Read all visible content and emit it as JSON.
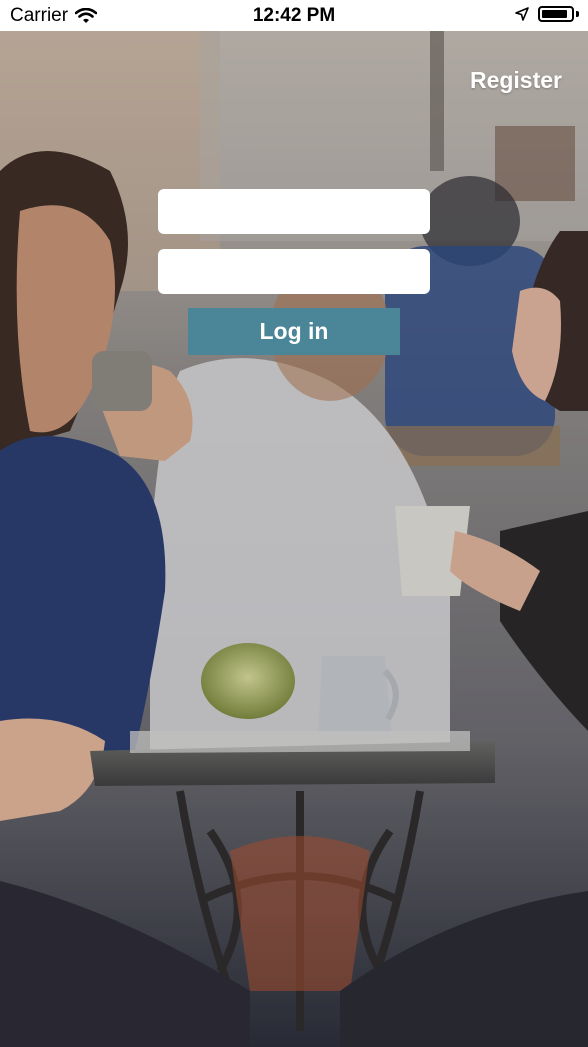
{
  "status_bar": {
    "carrier": "Carrier",
    "time": "12:42 PM",
    "battery_level": 0.9
  },
  "icons": {
    "wifi": "wifi-icon",
    "location": "location-arrow-icon",
    "battery": "battery-icon"
  },
  "nav": {
    "register_label": "Register"
  },
  "login_form": {
    "username_value": "",
    "password_value": "",
    "login_label": "Log in"
  },
  "colors": {
    "login_button": "#4a8698",
    "field_background": "#ffffff",
    "register_text": "#ffffff"
  }
}
